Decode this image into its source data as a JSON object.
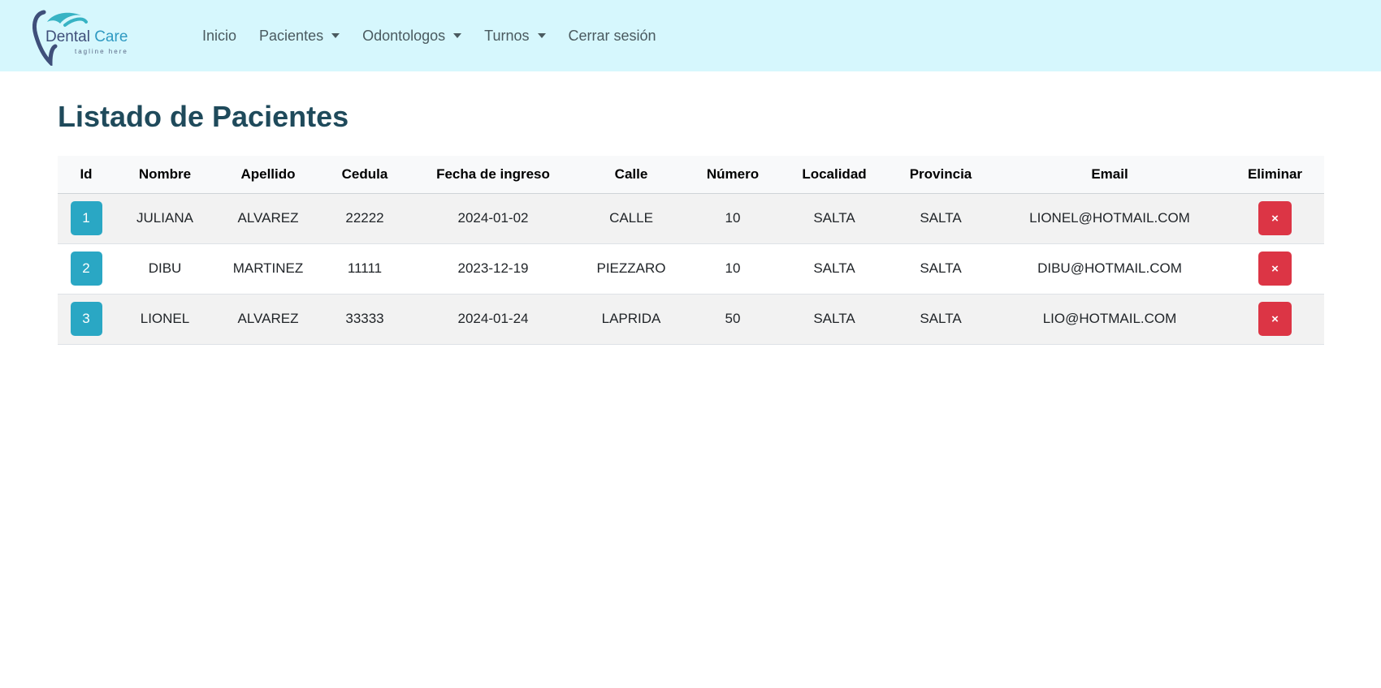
{
  "logo": {
    "word1": "Dental",
    "word2": "Care",
    "tagline": "tagline here"
  },
  "nav": {
    "items": [
      {
        "label": "Inicio",
        "dropdown": false
      },
      {
        "label": "Pacientes",
        "dropdown": true
      },
      {
        "label": "Odontologos",
        "dropdown": true
      },
      {
        "label": "Turnos",
        "dropdown": true
      },
      {
        "label": "Cerrar sesión",
        "dropdown": false
      }
    ]
  },
  "page": {
    "title": "Listado de Pacientes"
  },
  "table": {
    "columns": [
      "Id",
      "Nombre",
      "Apellido",
      "Cedula",
      "Fecha de ingreso",
      "Calle",
      "Número",
      "Localidad",
      "Provincia",
      "Email",
      "Eliminar"
    ],
    "delete_symbol": "×",
    "rows": [
      {
        "id": "1",
        "nombre": "JULIANA",
        "apellido": "ALVAREZ",
        "cedula": "22222",
        "fecha": "2024-01-02",
        "calle": "CALLE",
        "numero": "10",
        "localidad": "SALTA",
        "provincia": "SALTA",
        "email": "LIONEL@HOTMAIL.COM"
      },
      {
        "id": "2",
        "nombre": "DIBU",
        "apellido": "MARTINEZ",
        "cedula": "11111",
        "fecha": "2023-12-19",
        "calle": "PIEZZARO",
        "numero": "10",
        "localidad": "SALTA",
        "provincia": "SALTA",
        "email": "DIBU@HOTMAIL.COM"
      },
      {
        "id": "3",
        "nombre": "LIONEL",
        "apellido": "ALVAREZ",
        "cedula": "33333",
        "fecha": "2024-01-24",
        "calle": "LAPRIDA",
        "numero": "50",
        "localidad": "SALTA",
        "provincia": "SALTA",
        "email": "LIO@HOTMAIL.COM"
      }
    ]
  },
  "colors": {
    "navbar_bg": "#d6f7fd",
    "title": "#1f4a5b",
    "id_button": "#2aa7c4",
    "delete_button": "#dc3545"
  },
  "icons": {
    "logo": "tooth-icon",
    "dropdown": "caret-down-icon",
    "delete": "close-icon"
  }
}
